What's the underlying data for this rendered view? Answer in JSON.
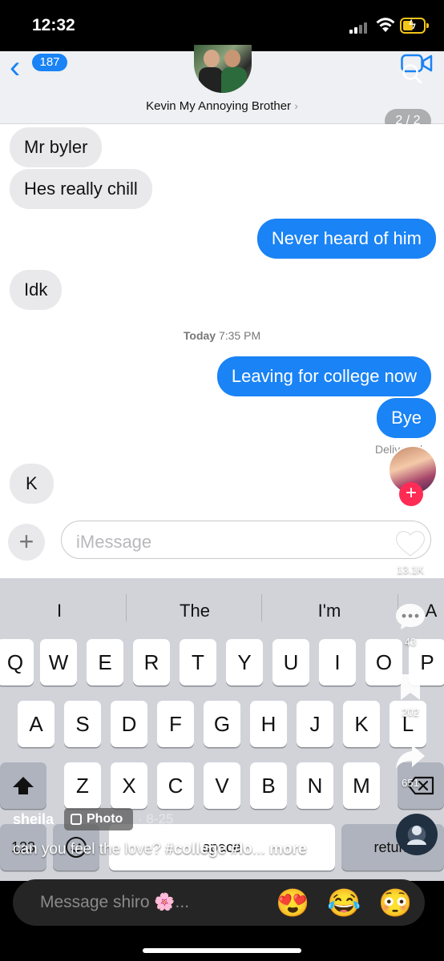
{
  "status_bar": {
    "time": "12:32"
  },
  "chat_header": {
    "unread_count": "187",
    "contact_name": "Kevin My Annoying Brother",
    "contact_chevron": "›",
    "page_indicator": "2 / 2"
  },
  "messages": [
    {
      "dir": "in",
      "text": "Mr byler"
    },
    {
      "dir": "in",
      "text": "Hes really chill"
    },
    {
      "dir": "out",
      "text": "Never heard of him"
    },
    {
      "dir": "in",
      "text": "Idk"
    },
    {
      "dir": "out",
      "text": "Leaving for college now"
    },
    {
      "dir": "out",
      "text": "Bye"
    },
    {
      "dir": "in",
      "text": "K"
    }
  ],
  "timestamp": {
    "day": "Today",
    "time": "7:35 PM"
  },
  "delivered_label": "Delivered",
  "input": {
    "plus_label": "+",
    "placeholder": "iMessage"
  },
  "keyboard": {
    "suggestions": [
      "I",
      "The",
      "I'm",
      "A"
    ],
    "row1": [
      "Q",
      "W",
      "E",
      "R",
      "T",
      "Y",
      "U",
      "I",
      "O",
      "P"
    ],
    "row2": [
      "A",
      "S",
      "D",
      "F",
      "G",
      "H",
      "J",
      "K",
      "L"
    ],
    "row3": [
      "Z",
      "X",
      "C",
      "V",
      "B",
      "N",
      "M"
    ],
    "numbers_key": "123",
    "space_key": "space",
    "return_key": "return"
  },
  "tiktok": {
    "like_count": "13.1K",
    "comment_count": "43",
    "bookmark_count": "202",
    "share_count": "651",
    "username": "sheila",
    "post_type": "Photo",
    "date": "· 8-25",
    "caption_prefix": "can you feel the love? ",
    "caption_tags": "#college #lo",
    "caption_ellipsis": "... ",
    "caption_more": "more",
    "comment_placeholder": "Message shiro 🌸...",
    "emojis": [
      "😍",
      "😂",
      "😳"
    ]
  }
}
